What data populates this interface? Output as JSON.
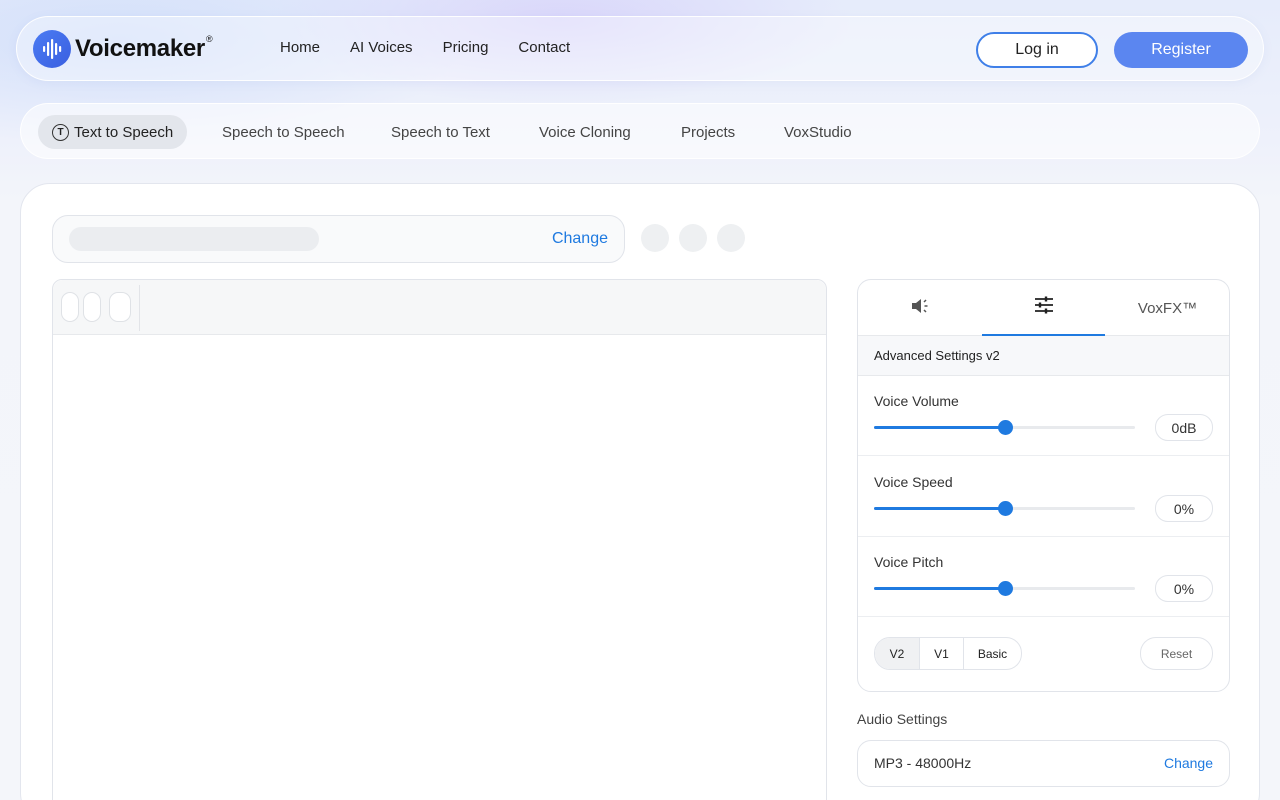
{
  "brand": {
    "name": "Voicemaker",
    "reg": "®"
  },
  "nav": [
    "Home",
    "AI Voices",
    "Pricing",
    "Contact"
  ],
  "auth": {
    "login": "Log in",
    "register": "Register"
  },
  "tools": [
    "Text to Speech",
    "Speech to Speech",
    "Speech to Text",
    "Voice Cloning",
    "Projects",
    "VoxStudio"
  ],
  "voice": {
    "change_label": "Change"
  },
  "settings": {
    "tabs": {
      "sound_icon": "speaker-icon",
      "sliders_icon": "sliders-icon",
      "voxfx": "VoxFX™"
    },
    "advanced_title": "Advanced Settings v2",
    "sliders": [
      {
        "label": "Voice Volume",
        "value": "0dB",
        "level": 0.5
      },
      {
        "label": "Voice Speed",
        "value": "0%",
        "level": 0.5
      },
      {
        "label": "Voice Pitch",
        "value": "0%",
        "level": 0.5
      }
    ],
    "versions": [
      "V2",
      "V1",
      "Basic"
    ],
    "reset": "Reset"
  },
  "audio": {
    "label": "Audio Settings",
    "value": "MP3 - 48000Hz",
    "change_label": "Change"
  },
  "colors": {
    "accent": "#1f7ae0",
    "register_bg": "#5b86f0",
    "login_border": "#3f7fe8"
  }
}
